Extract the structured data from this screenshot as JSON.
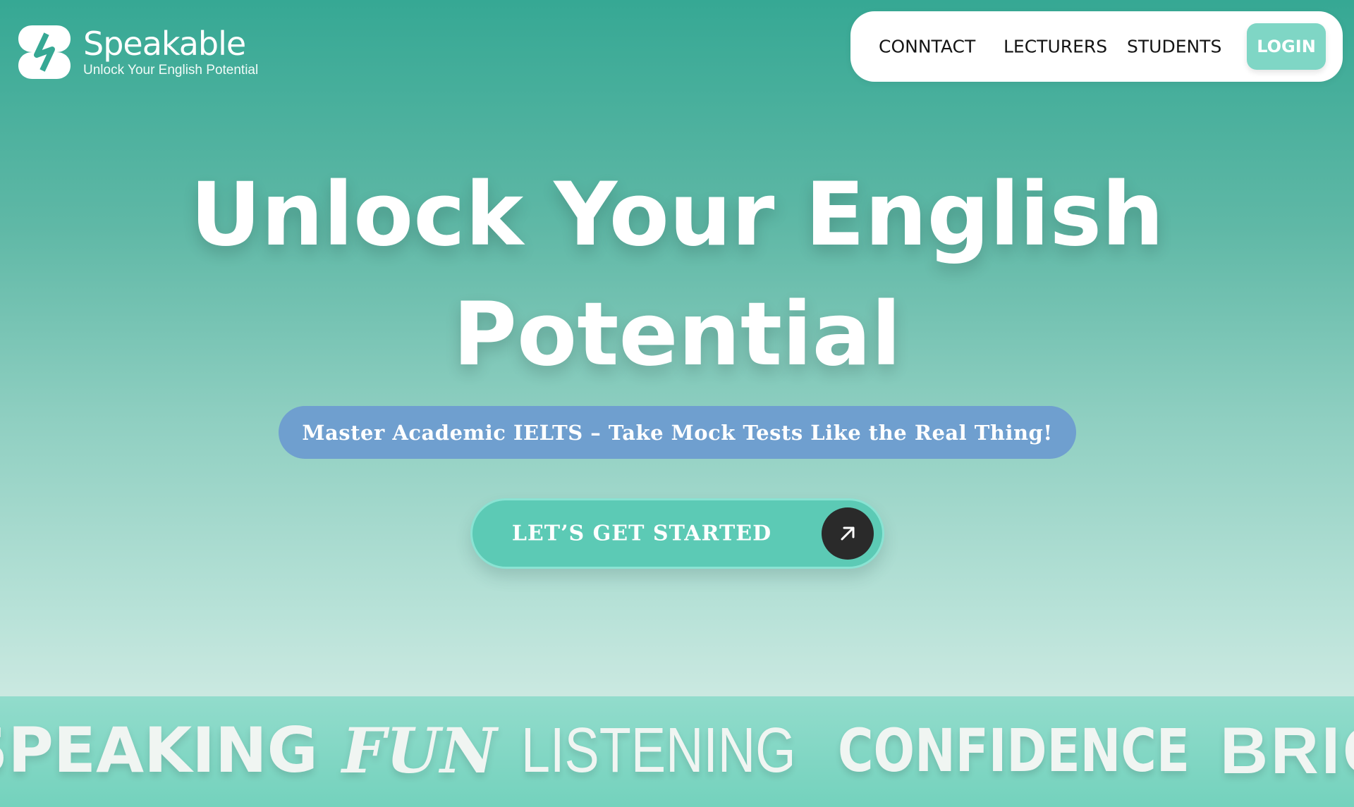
{
  "brand": {
    "name": "Speakable",
    "tagline": "Unlock Your English Potential"
  },
  "nav": {
    "items": [
      {
        "label": "CONNTACT"
      },
      {
        "label": "LECTURERS"
      },
      {
        "label": "STUDENTS"
      }
    ],
    "login_label": "LOGIN"
  },
  "hero": {
    "title_line1": "Unlock Your English",
    "title_line2": "Potential",
    "subtitle": "Master Academic IELTS – Take Mock Tests Like the Real Thing!",
    "cta_label": "LET’S GET STARTED",
    "cta_icon": "arrow-up-right-icon"
  },
  "marquee": {
    "words": [
      "SPEAKING",
      "FUN",
      "LISTENING",
      "CONFIDENCE",
      "BRIGHT"
    ]
  },
  "colors": {
    "gradient_top": "#36a894",
    "gradient_bottom": "#e3f1ec",
    "login_bg": "#7fd6c5",
    "subtitle_pill_bg": "#6f9fcf",
    "cta_bg": "#5ccab5",
    "cta_icon_bg": "#2a2a2a",
    "marquee_bg": "#7fd6c5"
  }
}
